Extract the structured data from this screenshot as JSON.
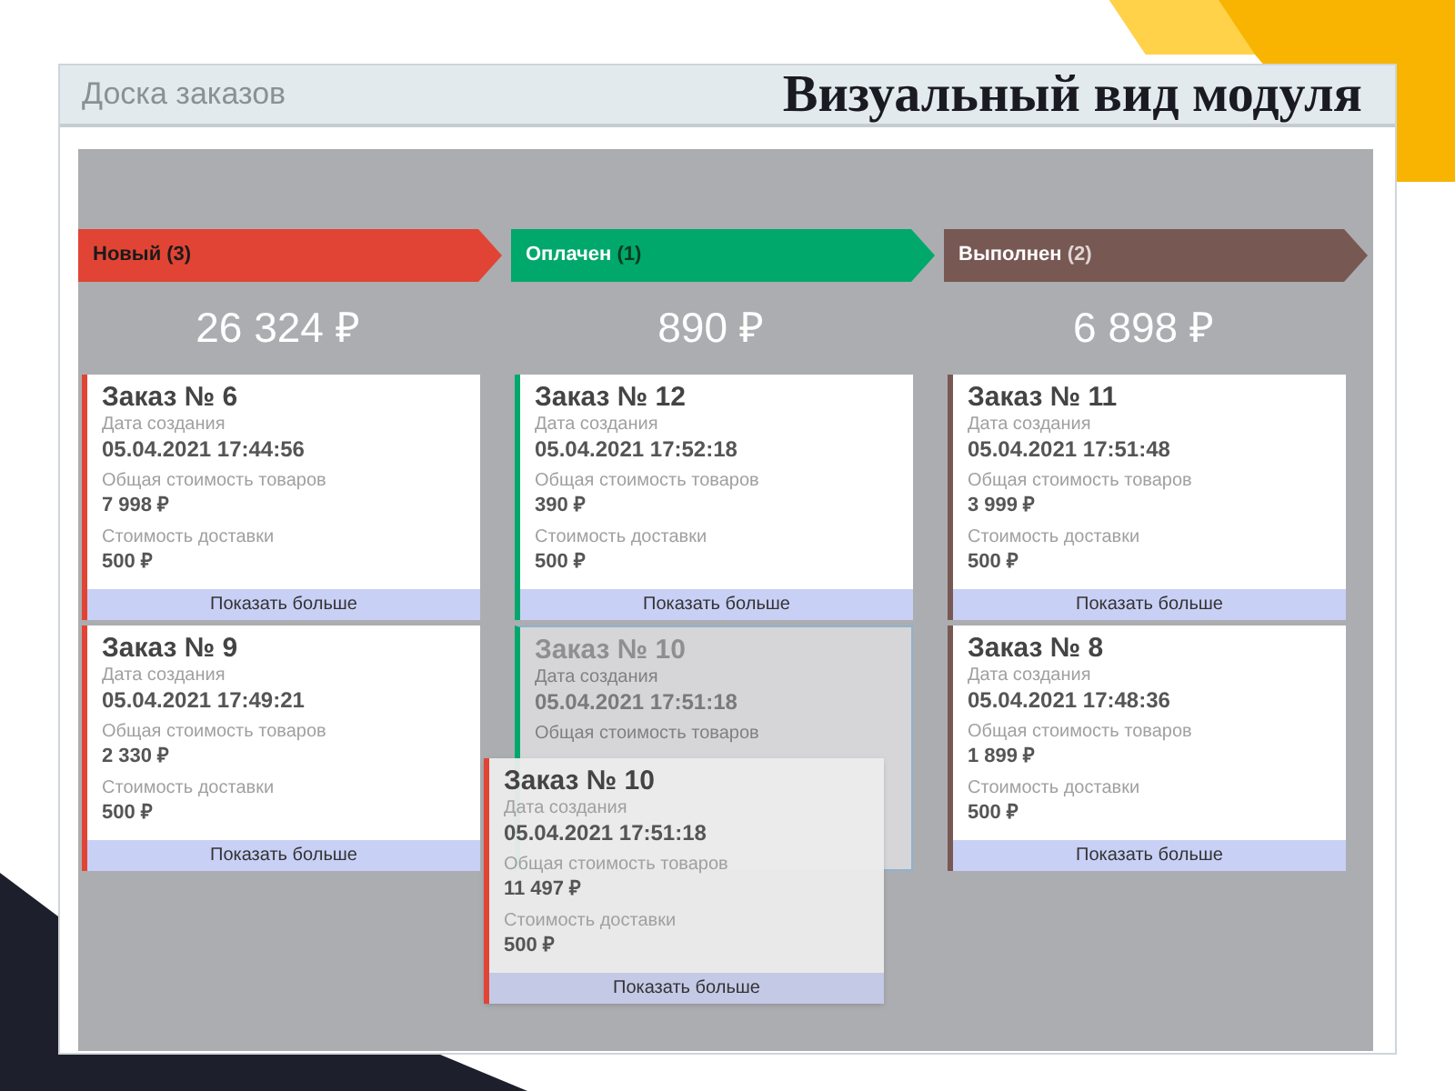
{
  "header": {
    "title": "Доска заказов",
    "caption": "Визуальный вид модуля"
  },
  "columns": [
    {
      "kind": "new",
      "label": "Новый",
      "count": "(3)",
      "color": "#e14434",
      "total": "26 324 ₽",
      "cards": [
        {
          "kind": "normal",
          "title": "Заказ № 6",
          "date_label": "Дата создания",
          "date": "05.04.2021 17:44:56",
          "goods_label": "Общая стоимость товаров",
          "goods": "7 998 ₽",
          "delivery_label": "Стоимость доставки",
          "delivery": "500 ₽",
          "more": "Показать больше"
        },
        {
          "kind": "normal",
          "title": "Заказ № 9",
          "date_label": "Дата создания",
          "date": "05.04.2021 17:49:21",
          "goods_label": "Общая стоимость товаров",
          "goods": "2 330 ₽",
          "delivery_label": "Стоимость доставки",
          "delivery": "500 ₽",
          "more": "Показать больше"
        }
      ]
    },
    {
      "kind": "paid",
      "label": "Оплачен",
      "count": "(1)",
      "color": "#00a86b",
      "total": "890 ₽",
      "cards": [
        {
          "kind": "normal",
          "title": "Заказ № 12",
          "date_label": "Дата создания",
          "date": "05.04.2021 17:52:18",
          "goods_label": "Общая стоимость товаров",
          "goods": "390 ₽",
          "delivery_label": "Стоимость доставки",
          "delivery": "500 ₽",
          "more": "Показать больше"
        },
        {
          "kind": "placeholder",
          "title": "Заказ № 10",
          "date_label": "Дата создания",
          "date": "05.04.2021 17:51:18",
          "goods_label": "Общая стоимость товаров"
        }
      ]
    },
    {
      "kind": "done",
      "label": "Выполнен",
      "count": "(2)",
      "color": "#785853",
      "total": "6 898 ₽",
      "cards": [
        {
          "kind": "normal",
          "title": "Заказ № 11",
          "date_label": "Дата создания",
          "date": "05.04.2021 17:51:48",
          "goods_label": "Общая стоимость товаров",
          "goods": "3 999 ₽",
          "delivery_label": "Стоимость доставки",
          "delivery": "500 ₽",
          "more": "Показать больше"
        },
        {
          "kind": "normal",
          "title": "Заказ № 8",
          "date_label": "Дата создания",
          "date": "05.04.2021 17:48:36",
          "goods_label": "Общая стоимость товаров",
          "goods": "1 899 ₽",
          "delivery_label": "Стоимость доставки",
          "delivery": "500 ₽",
          "more": "Показать больше"
        }
      ]
    }
  ],
  "dragged_card": {
    "title": "Заказ № 10",
    "color": "#e14434",
    "date_label": "Дата создания",
    "date": "05.04.2021 17:51:18",
    "goods_label": "Общая стоимость товаров",
    "goods": "11 497 ₽",
    "delivery_label": "Стоимость доставки",
    "delivery": "500 ₽",
    "more": "Показать больше"
  }
}
